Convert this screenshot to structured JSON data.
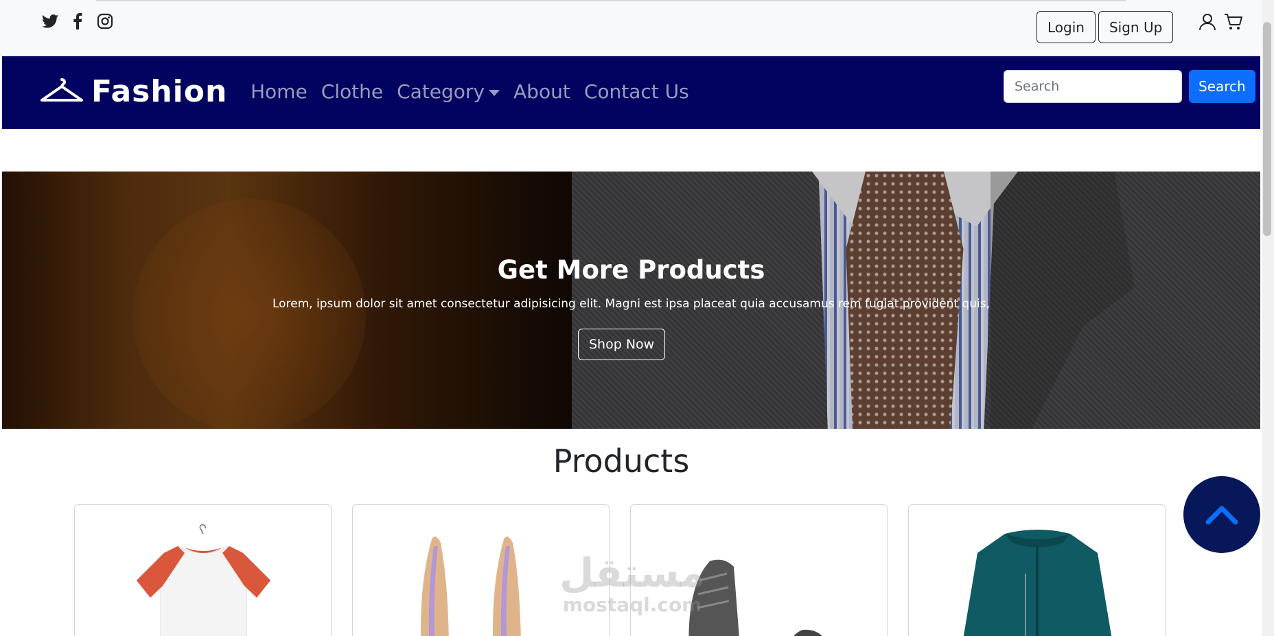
{
  "social": {
    "icons": [
      "twitter-icon",
      "facebook-icon",
      "instagram-icon"
    ]
  },
  "auth": {
    "login_label": "Login",
    "signup_label": "Sign Up"
  },
  "user_icons": [
    "user-icon",
    "cart-icon"
  ],
  "brand": {
    "name": "Fashion",
    "logo_icon": "hanger-icon"
  },
  "nav": {
    "links": [
      {
        "label": "Home"
      },
      {
        "label": "Clothe"
      },
      {
        "label": "Category",
        "dropdown": true
      },
      {
        "label": "About"
      },
      {
        "label": "Contact Us"
      }
    ]
  },
  "search": {
    "placeholder": "Search",
    "button_label": "Search"
  },
  "hero": {
    "title": "Get More Products",
    "text": "Lorem, ipsum dolor sit amet consectetur adipisicing elit. Magni est ipsa placeat quia accusamus rem fugiat provident quis,",
    "button_label": "Shop Now"
  },
  "products": {
    "title": "Products",
    "items": [
      {
        "image": "raglan-tshirt-image"
      },
      {
        "image": "high-heels-image"
      },
      {
        "image": "sneakers-image"
      },
      {
        "image": "teal-jacket-image"
      }
    ]
  },
  "watermark": {
    "arabic": "مستقل",
    "latin": "mostaql.com"
  },
  "colors": {
    "navbar": "#020360",
    "primary": "#0d6efd",
    "back_to_top": "#06175a",
    "back_to_top_arrow": "#0d6efd"
  }
}
